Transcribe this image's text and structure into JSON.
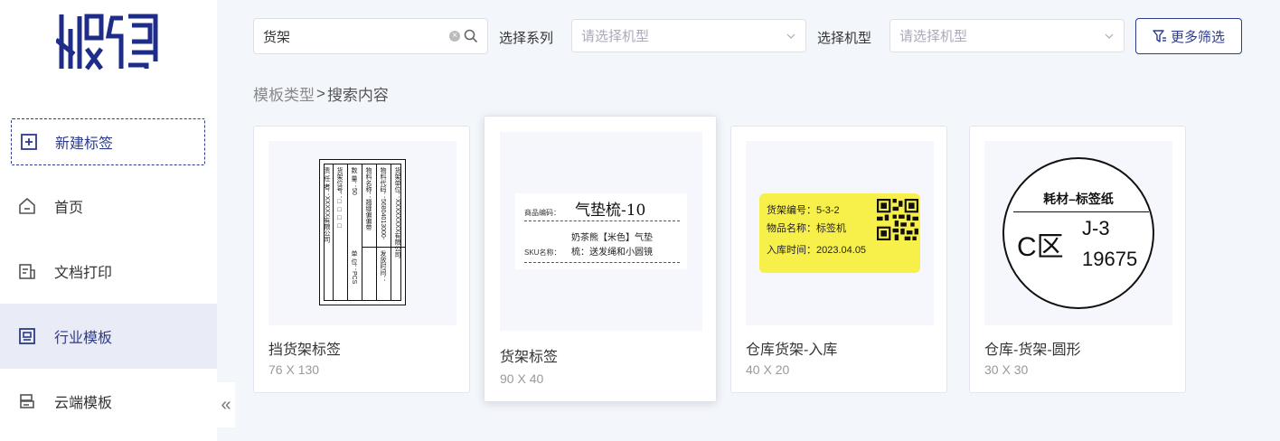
{
  "app": {
    "logo_text": "标码"
  },
  "sidebar": {
    "new_label": "新建标签",
    "items": [
      {
        "label": "首页",
        "icon": "home-icon"
      },
      {
        "label": "文档打印",
        "icon": "document-print-icon"
      },
      {
        "label": "行业模板",
        "icon": "industry-template-icon",
        "active": true
      },
      {
        "label": "云端模板",
        "icon": "cloud-template-icon"
      }
    ],
    "collapse": "«"
  },
  "toolbar": {
    "search_value": "货架",
    "series_label": "选择系列",
    "series_placeholder": "请选择机型",
    "model_label": "选择机型",
    "model_placeholder": "请选择机型",
    "more_filter": "更多筛选"
  },
  "breadcrumb": {
    "parent": "模板类型",
    "sep": ">",
    "current": "搜索内容"
  },
  "cards": [
    {
      "name": "挡货架标签",
      "size": "76 X 130",
      "preview": {
        "rows": [
          "货架单位：XXXXXXXX有限公司",
          "物料代码：56804013000-12",
          "物料名称：翘缝偏偏带（1525）",
          "数 量：50",
          "货架位号：□ □ □ □",
          "责 任 者：XXXXX有限公司"
        ],
        "cols": [
          "发放时间：2023.5.11",
          "单 位：PCS"
        ]
      }
    },
    {
      "name": "货架标签",
      "size": "90 X 40",
      "preview": {
        "code_label": "商品编码：",
        "code": "气垫梳-10",
        "sku_label": "SKU名称：",
        "sku_line1": "奶茶熊【米色】气垫",
        "sku_line2": "梳：送发绳和小圆镜"
      }
    },
    {
      "name": "仓库货架-入库",
      "size": "40 X 20",
      "preview": {
        "line1": "货架编号：5-3-2",
        "line2": "物品名称：标签机",
        "line3": "入库时间：2023.04.05",
        "bg": "#f8f04a"
      }
    },
    {
      "name": "仓库-货架-圆形",
      "size": "30 X 30",
      "preview": {
        "title": "耗材–标签纸",
        "area": "C区",
        "code1": "J-3",
        "code2": "19675"
      }
    }
  ],
  "colors": {
    "accent": "#2c3a8c",
    "active_bg": "#e9ecf6",
    "page_bg": "#f3f6fb"
  }
}
